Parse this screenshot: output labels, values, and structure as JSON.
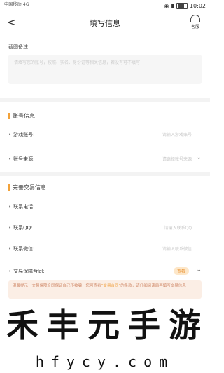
{
  "status_bar": {
    "carrier_left": "中国移动 4G",
    "time": "10:02"
  },
  "nav": {
    "back": "<",
    "title": "填写信息",
    "service_label": "客服"
  },
  "remark": {
    "label": "截图备注",
    "placeholder": "请填写您的账号，按照、实名、身份证等相关信息，若没有可不填写"
  },
  "account": {
    "title": "账号信息",
    "rows": [
      {
        "label": "游戏账号:",
        "value": "请输入游戏账号"
      },
      {
        "label": "账号来源:",
        "value": "请选择账号来源"
      }
    ]
  },
  "trade": {
    "title": "完善交易信息",
    "rows": [
      {
        "label": "联系电话:",
        "value": ""
      },
      {
        "label": "联系QQ:",
        "value": "请输入联系QQ"
      },
      {
        "label": "联系微信:",
        "value": "请输入联系微信"
      },
      {
        "label": "交易保障合同:",
        "badge": "查看"
      }
    ]
  },
  "notice": {
    "text": "温馨提示：交易保障合同保证自己不被骗，您可查看",
    "highlight": "“交易合同”",
    "text2": "的条款，请仔细阅读后再填写交易信息"
  },
  "watermark": {
    "chars": [
      "禾",
      "丰",
      "元",
      "手",
      "游"
    ],
    "url": "hfycy.com"
  }
}
